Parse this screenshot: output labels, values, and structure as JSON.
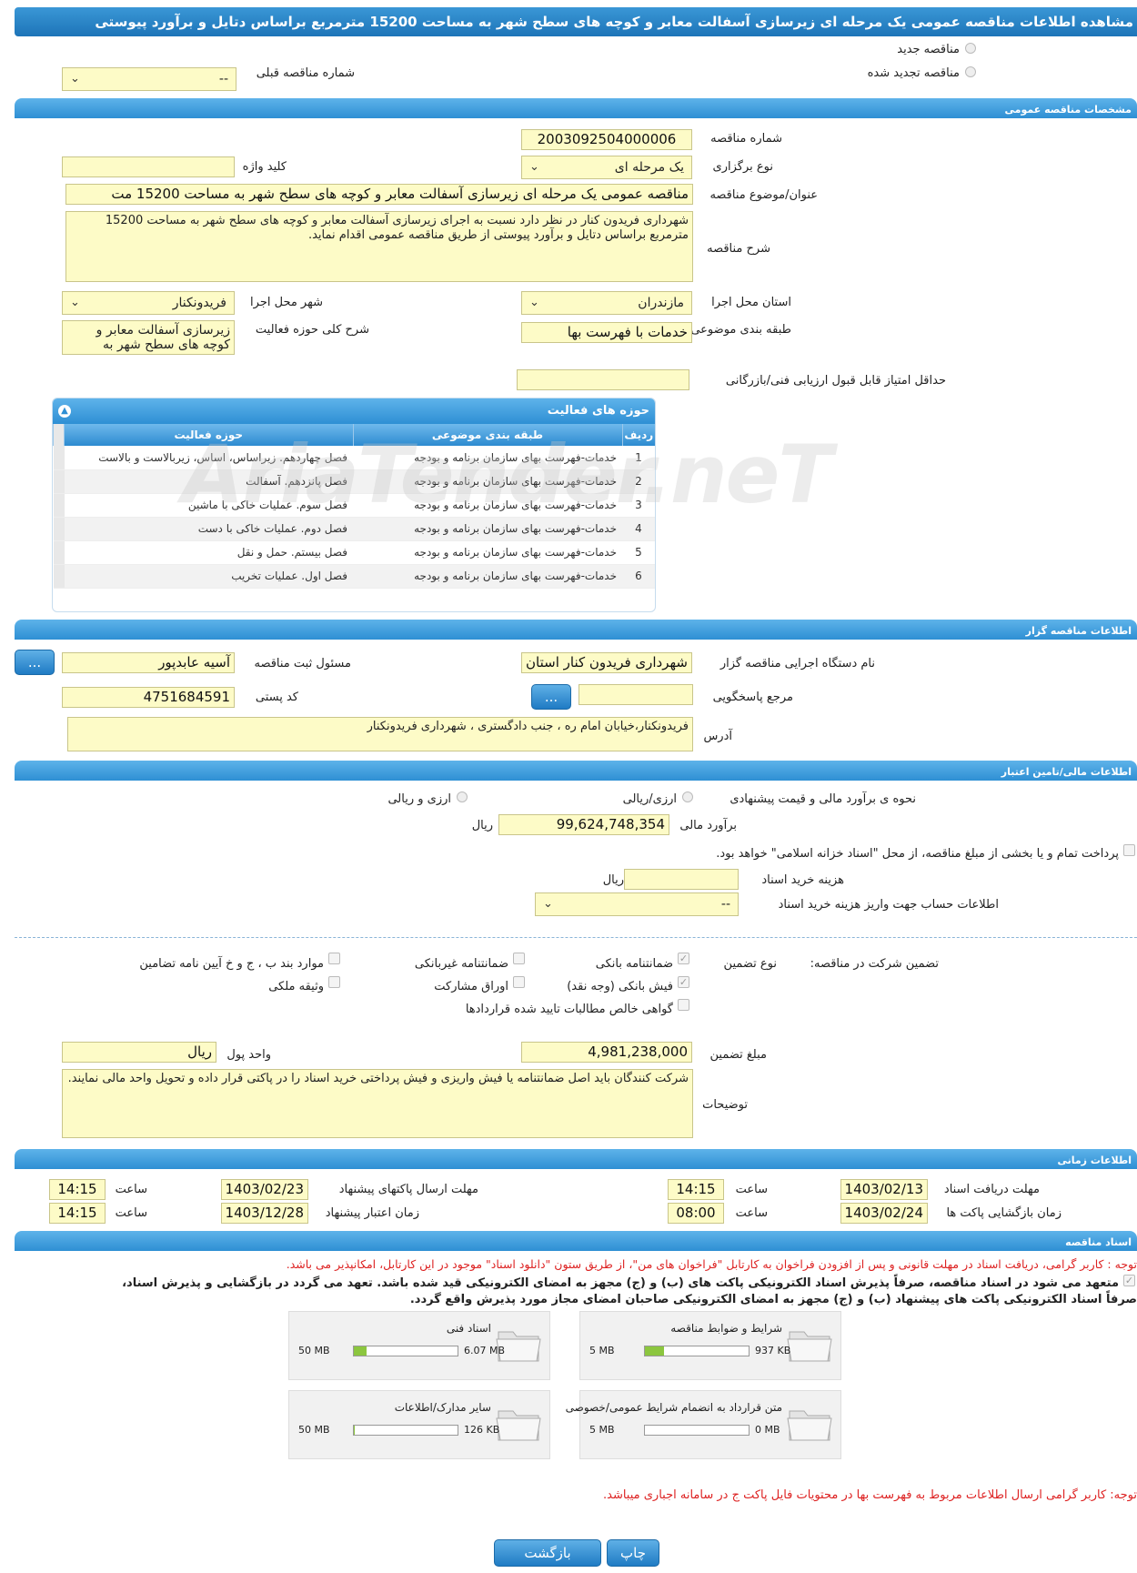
{
  "title": "مشاهده اطلاعات مناقصه عمومی یک مرحله ای زیرسازی آسفالت معابر و کوچه های سطح شهر به مساحت 15200 مترمربع براساس دتایل و برآورد پیوستی",
  "top": {
    "new_tender": "مناقصه جدید",
    "renewed_tender": "مناقصه تجدید شده",
    "prev_number_label": "شماره مناقصه قبلی",
    "prev_number_value": "--"
  },
  "general": {
    "header": "مشخصات مناقصه عمومی",
    "number_label": "شماره مناقصه",
    "number_value": "2003092504000006",
    "type_label": "نوع برگزاری",
    "type_value": "یک مرحله ای",
    "keyword_label": "کلید واژه",
    "keyword_value": "",
    "subject_label": "عنوان/موضوع مناقصه",
    "subject_value": "مناقصه عمومی یک مرحله ای زیرسازی آسفالت معابر و کوچه های سطح شهر به مساحت 15200 مت",
    "desc_label": "شرح مناقصه",
    "desc_value": "شهرداری فریدون کنار در نظر دارد نسبت به اجرای زیرسازی آسفالت معابر و کوچه های سطح شهر به مساحت 15200 مترمربع براساس دتایل و برآورد پیوستی از طریق مناقصه عمومی اقدام نماید.",
    "province_label": "استان محل اجرا",
    "province_value": "مازندران",
    "city_label": "شهر محل اجرا",
    "city_value": "فریدونکنار",
    "category_label": "طبقه بندی موضوعی",
    "category_value": "خدمات با فهرست بها",
    "scope_label": "شرح کلی حوزه فعالیت",
    "scope_value": "زیرسازی آسفالت معابر و کوچه های سطح شهر به",
    "min_score_label": "حداقل امتیاز قابل قبول ارزیابی فنی/بازرگانی",
    "min_score_value": ""
  },
  "activity": {
    "header": "حوزه های فعالیت",
    "col_row": "ردیف",
    "col_category": "طبقه بندی موضوعی",
    "col_scope": "حوزه فعالیت",
    "rows": [
      {
        "n": "1",
        "category": "خدمات-فهرست بهای سازمان برنامه و بودجه",
        "scope": "فصل چهاردهم. زیراساس، اساس، زیربالاست  و بالاست"
      },
      {
        "n": "2",
        "category": "خدمات-فهرست بهای سازمان برنامه و بودجه",
        "scope": "فصل پانزدهم. آسفالت"
      },
      {
        "n": "3",
        "category": "خدمات-فهرست بهای سازمان برنامه و بودجه",
        "scope": "فصل سوم. عملیات خاکی با ماشین"
      },
      {
        "n": "4",
        "category": "خدمات-فهرست بهای سازمان برنامه و بودجه",
        "scope": "فصل دوم. عملیات خاکی با دست"
      },
      {
        "n": "5",
        "category": "خدمات-فهرست بهای سازمان برنامه و بودجه",
        "scope": "فصل بیستم. حمل و نقل"
      },
      {
        "n": "6",
        "category": "خدمات-فهرست بهای سازمان برنامه و بودجه",
        "scope": "فصل اول. عملیات تخریب"
      }
    ]
  },
  "organizer": {
    "header": "اطلاعات مناقصه گزار",
    "org_label": "نام دستگاه اجرایی مناقصه گزار",
    "org_value": "شهرداری فریدون کنار استان",
    "officer_label": "مسئول ثبت مناقصه",
    "officer_value": "آسیه عابدپور",
    "ref_label": "مرجع پاسخگویی",
    "ref_value": "",
    "postal_label": "کد پستی",
    "postal_value": "4751684591",
    "address_label": "آدرس",
    "address_value": "فریدونکنار،خیابان امام ره ، جنب دادگستری ، شهرداری فریدونکنار",
    "dots": "..."
  },
  "finance": {
    "header": "اطلاعات مالی/تامین اعتبار",
    "method_label": "نحوه ی برآورد مالی و قیمت پیشنهادی",
    "opt1": "ارزی/ریالی",
    "opt2": "ارزی و ریالی",
    "estimate_label": "برآورد مالی",
    "estimate_value": "99,624,748,354",
    "rial": "ریال",
    "treasury_text": "پرداخت تمام و یا بخشی از مبلغ مناقصه، از محل \"اسناد خزانه اسلامی\" خواهد بود.",
    "doc_cost_label": "هزینه خرید اسناد",
    "doc_cost_value": "",
    "account_label": "اطلاعات حساب جهت واریز هزینه خرید اسناد",
    "account_value": "--"
  },
  "guarantee": {
    "label": "تضمین شرکت در مناقصه:",
    "type_label": "نوع تضمین",
    "items": {
      "bank": "ضمانتنامه بانکی",
      "nonbank": "ضمانتنامه غیربانکی",
      "clauses": "موارد بند ب ، ج و خ آیین نامه تضامین",
      "receipt": "فیش بانکی (وجه نقد)",
      "bonds": "اوراق مشارکت",
      "property": "وثیقه ملکی",
      "certificate": "گواهی خالص مطالبات تایید شده قراردادها"
    },
    "amount_label": "مبلغ تضمین",
    "amount_value": "4,981,238,000",
    "currency_label": "واحد پول",
    "currency_value": "ریال",
    "notes_label": "توضیحات",
    "notes_value": "شرکت کنندگان باید اصل ضمانتنامه یا فیش واریزی و فیش پرداختی خرید اسناد را در پاکتی قرار داده و تحویل واحد مالی نمایند."
  },
  "timing": {
    "header": "اطلاعات زمانی",
    "receive_label": "مهلت دریافت اسناد",
    "receive_date": "1403/02/13",
    "receive_time": "14:15",
    "send_label": "مهلت ارسال پاکتهای پیشنهاد",
    "send_date": "1403/02/23",
    "send_time": "14:15",
    "open_label": "زمان بازگشایی پاکت ها",
    "open_date": "1403/02/24",
    "open_time": "08:00",
    "valid_label": "زمان اعتبار پیشنهاد",
    "valid_date": "1403/12/28",
    "valid_time": "14:15",
    "hour": "ساعت"
  },
  "docs": {
    "header": "اسناد مناقصه",
    "note1": "توجه : کاربر گرامی، دریافت اسناد در مهلت قانونی و پس از افزودن فراخوان به کارتابل \"فراخوان های من\"، از طریق ستون \"دانلود اسناد\" موجود در این کارتابل، امکانپذیر می باشد.",
    "commit1": "متعهد می شود در اسناد مناقصه، صرفاً پذیرش اسناد الکترونیکی پاکت های (ب) و (ج) مجهز به امضای الکترونیکی قید شده باشد. تعهد می گردد در بازگشایی و پذیرش اسناد،",
    "commit2": "صرفاً اسناد الکترونیکی پاکت های پیشنهاد (ب) و (ج) مجهز به امضای الکترونیکی صاحبان امضای مجاز مورد پذیرش واقع گردد.",
    "files": [
      {
        "name": "شرایط و ضوابط مناقصه",
        "size": "937 KB",
        "max": "5 MB",
        "fill": 0.18
      },
      {
        "name": "اسناد فنی",
        "size": "6.07 MB",
        "max": "50 MB",
        "fill": 0.12
      },
      {
        "name": "متن قرارداد به انضمام شرایط عمومی/خصوصی",
        "size": "0 MB",
        "max": "5 MB",
        "fill": 0.0
      },
      {
        "name": "سایر مدارک/اطلاعات",
        "size": "126 KB",
        "max": "50 MB",
        "fill": 0.01
      }
    ],
    "note2": "توجه: کاربر گرامی ارسال اطلاعات مربوط به فهرست بها در محتویات فایل پاکت ج در سامانه اجباری میباشد."
  },
  "buttons": {
    "back": "بازگشت",
    "print": "چاپ"
  },
  "watermark": "AriaTender.neT"
}
